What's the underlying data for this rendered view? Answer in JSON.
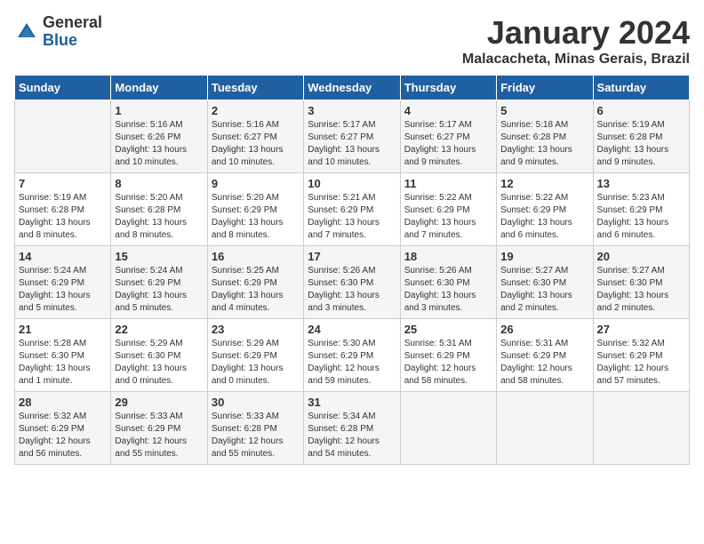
{
  "logo": {
    "general": "General",
    "blue": "Blue"
  },
  "title": "January 2024",
  "subtitle": "Malacacheta, Minas Gerais, Brazil",
  "days_header": [
    "Sunday",
    "Monday",
    "Tuesday",
    "Wednesday",
    "Thursday",
    "Friday",
    "Saturday"
  ],
  "weeks": [
    [
      {
        "day": "",
        "info": ""
      },
      {
        "day": "1",
        "info": "Sunrise: 5:16 AM\nSunset: 6:26 PM\nDaylight: 13 hours\nand 10 minutes."
      },
      {
        "day": "2",
        "info": "Sunrise: 5:16 AM\nSunset: 6:27 PM\nDaylight: 13 hours\nand 10 minutes."
      },
      {
        "day": "3",
        "info": "Sunrise: 5:17 AM\nSunset: 6:27 PM\nDaylight: 13 hours\nand 10 minutes."
      },
      {
        "day": "4",
        "info": "Sunrise: 5:17 AM\nSunset: 6:27 PM\nDaylight: 13 hours\nand 9 minutes."
      },
      {
        "day": "5",
        "info": "Sunrise: 5:18 AM\nSunset: 6:28 PM\nDaylight: 13 hours\nand 9 minutes."
      },
      {
        "day": "6",
        "info": "Sunrise: 5:19 AM\nSunset: 6:28 PM\nDaylight: 13 hours\nand 9 minutes."
      }
    ],
    [
      {
        "day": "7",
        "info": "Sunrise: 5:19 AM\nSunset: 6:28 PM\nDaylight: 13 hours\nand 8 minutes."
      },
      {
        "day": "8",
        "info": "Sunrise: 5:20 AM\nSunset: 6:28 PM\nDaylight: 13 hours\nand 8 minutes."
      },
      {
        "day": "9",
        "info": "Sunrise: 5:20 AM\nSunset: 6:29 PM\nDaylight: 13 hours\nand 8 minutes."
      },
      {
        "day": "10",
        "info": "Sunrise: 5:21 AM\nSunset: 6:29 PM\nDaylight: 13 hours\nand 7 minutes."
      },
      {
        "day": "11",
        "info": "Sunrise: 5:22 AM\nSunset: 6:29 PM\nDaylight: 13 hours\nand 7 minutes."
      },
      {
        "day": "12",
        "info": "Sunrise: 5:22 AM\nSunset: 6:29 PM\nDaylight: 13 hours\nand 6 minutes."
      },
      {
        "day": "13",
        "info": "Sunrise: 5:23 AM\nSunset: 6:29 PM\nDaylight: 13 hours\nand 6 minutes."
      }
    ],
    [
      {
        "day": "14",
        "info": "Sunrise: 5:24 AM\nSunset: 6:29 PM\nDaylight: 13 hours\nand 5 minutes."
      },
      {
        "day": "15",
        "info": "Sunrise: 5:24 AM\nSunset: 6:29 PM\nDaylight: 13 hours\nand 5 minutes."
      },
      {
        "day": "16",
        "info": "Sunrise: 5:25 AM\nSunset: 6:29 PM\nDaylight: 13 hours\nand 4 minutes."
      },
      {
        "day": "17",
        "info": "Sunrise: 5:26 AM\nSunset: 6:30 PM\nDaylight: 13 hours\nand 3 minutes."
      },
      {
        "day": "18",
        "info": "Sunrise: 5:26 AM\nSunset: 6:30 PM\nDaylight: 13 hours\nand 3 minutes."
      },
      {
        "day": "19",
        "info": "Sunrise: 5:27 AM\nSunset: 6:30 PM\nDaylight: 13 hours\nand 2 minutes."
      },
      {
        "day": "20",
        "info": "Sunrise: 5:27 AM\nSunset: 6:30 PM\nDaylight: 13 hours\nand 2 minutes."
      }
    ],
    [
      {
        "day": "21",
        "info": "Sunrise: 5:28 AM\nSunset: 6:30 PM\nDaylight: 13 hours\nand 1 minute."
      },
      {
        "day": "22",
        "info": "Sunrise: 5:29 AM\nSunset: 6:30 PM\nDaylight: 13 hours\nand 0 minutes."
      },
      {
        "day": "23",
        "info": "Sunrise: 5:29 AM\nSunset: 6:29 PM\nDaylight: 13 hours\nand 0 minutes."
      },
      {
        "day": "24",
        "info": "Sunrise: 5:30 AM\nSunset: 6:29 PM\nDaylight: 12 hours\nand 59 minutes."
      },
      {
        "day": "25",
        "info": "Sunrise: 5:31 AM\nSunset: 6:29 PM\nDaylight: 12 hours\nand 58 minutes."
      },
      {
        "day": "26",
        "info": "Sunrise: 5:31 AM\nSunset: 6:29 PM\nDaylight: 12 hours\nand 58 minutes."
      },
      {
        "day": "27",
        "info": "Sunrise: 5:32 AM\nSunset: 6:29 PM\nDaylight: 12 hours\nand 57 minutes."
      }
    ],
    [
      {
        "day": "28",
        "info": "Sunrise: 5:32 AM\nSunset: 6:29 PM\nDaylight: 12 hours\nand 56 minutes."
      },
      {
        "day": "29",
        "info": "Sunrise: 5:33 AM\nSunset: 6:29 PM\nDaylight: 12 hours\nand 55 minutes."
      },
      {
        "day": "30",
        "info": "Sunrise: 5:33 AM\nSunset: 6:28 PM\nDaylight: 12 hours\nand 55 minutes."
      },
      {
        "day": "31",
        "info": "Sunrise: 5:34 AM\nSunset: 6:28 PM\nDaylight: 12 hours\nand 54 minutes."
      },
      {
        "day": "",
        "info": ""
      },
      {
        "day": "",
        "info": ""
      },
      {
        "day": "",
        "info": ""
      }
    ]
  ]
}
